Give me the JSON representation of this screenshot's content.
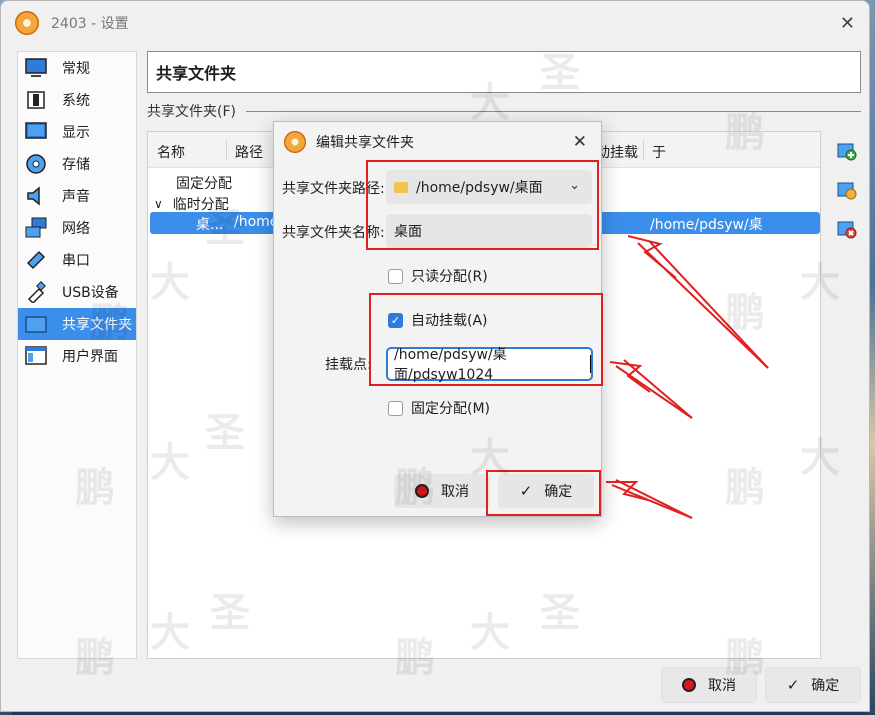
{
  "window": {
    "title": "2403 - 设置",
    "page_title": "共享文件夹"
  },
  "sidebar": {
    "items": [
      {
        "label": "常规",
        "icon": "monitor-icon"
      },
      {
        "label": "系统",
        "icon": "chip-icon"
      },
      {
        "label": "显示",
        "icon": "display-icon"
      },
      {
        "label": "存储",
        "icon": "disk-icon"
      },
      {
        "label": "声音",
        "icon": "speaker-icon"
      },
      {
        "label": "网络",
        "icon": "network-icon"
      },
      {
        "label": "串口",
        "icon": "serial-icon"
      },
      {
        "label": "USB设备",
        "icon": "usb-icon"
      },
      {
        "label": "共享文件夹",
        "icon": "folder-icon"
      },
      {
        "label": "用户界面",
        "icon": "window-ui-icon"
      }
    ],
    "active_index": 8
  },
  "shared": {
    "group_label": "共享文件夹(F)",
    "columns": {
      "name": "名称",
      "path": "路径",
      "automount": "动挂载",
      "at": "于"
    },
    "tree": {
      "fixed": "固定分配",
      "temp": "临时分配",
      "row_name": "桌...",
      "row_path": "/home",
      "row_mount": "/home/pdsyw/桌面/back···"
    }
  },
  "dialog": {
    "title": "编辑共享文件夹",
    "path_label": "共享文件夹路径:",
    "path_value": "/home/pdsyw/桌面",
    "name_label": "共享文件夹名称:",
    "name_value": "桌面",
    "readonly_label": "只读分配(R)",
    "automount_label": "自动挂载(A)",
    "mountpoint_label": "挂载点:",
    "mountpoint_value": "/home/pdsyw/桌面/pdsyw1024",
    "permanent_label": "固定分配(M)",
    "cancel_label": "取消",
    "ok_label": "确定",
    "readonly_checked": false,
    "automount_checked": true,
    "permanent_checked": false
  },
  "footer": {
    "cancel_label": "取消",
    "ok_label": "确定"
  },
  "colors": {
    "accent": "#3b8eea",
    "annotation": "#e02020"
  }
}
